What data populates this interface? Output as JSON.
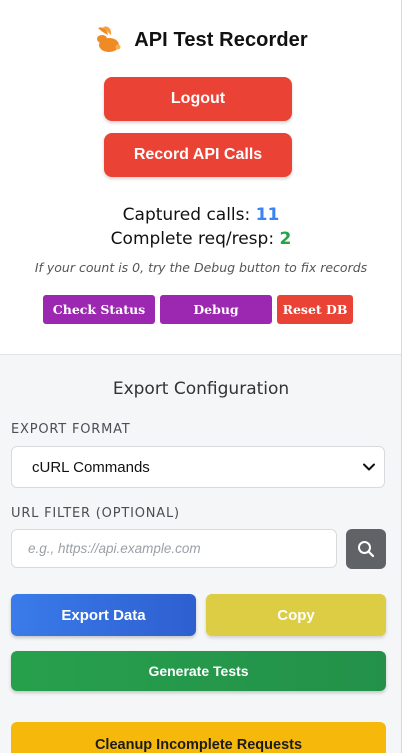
{
  "header": {
    "title": "API Test Recorder",
    "logo_icon": "rabbit-logo-icon"
  },
  "auth": {
    "logout_label": "Logout"
  },
  "recorder": {
    "record_label": "Record API Calls"
  },
  "stats": {
    "captured_label": "Captured calls:",
    "captured_count": "11",
    "complete_label": "Complete req/resp:",
    "complete_count": "2",
    "hint": "If your count is 0, try the Debug button to fix records"
  },
  "tools": {
    "check_status_label": "Check Status",
    "debug_label": "Debug",
    "reset_db_label": "Reset DB"
  },
  "export": {
    "title": "Export Configuration",
    "format_label": "EXPORT FORMAT",
    "format_selected": "cURL Commands",
    "filter_label": "URL FILTER (OPTIONAL)",
    "filter_placeholder": "e.g., https://api.example.com",
    "export_label": "Export Data",
    "copy_label": "Copy",
    "generate_label": "Generate Tests",
    "cleanup_label": "Cleanup Incomplete Requests"
  },
  "colors": {
    "red": "#ea4335",
    "purple": "#9c27b0",
    "blue": "#3b82f6",
    "green": "#22a447",
    "yellow": "#dccd45",
    "amber": "#f6b90b"
  }
}
